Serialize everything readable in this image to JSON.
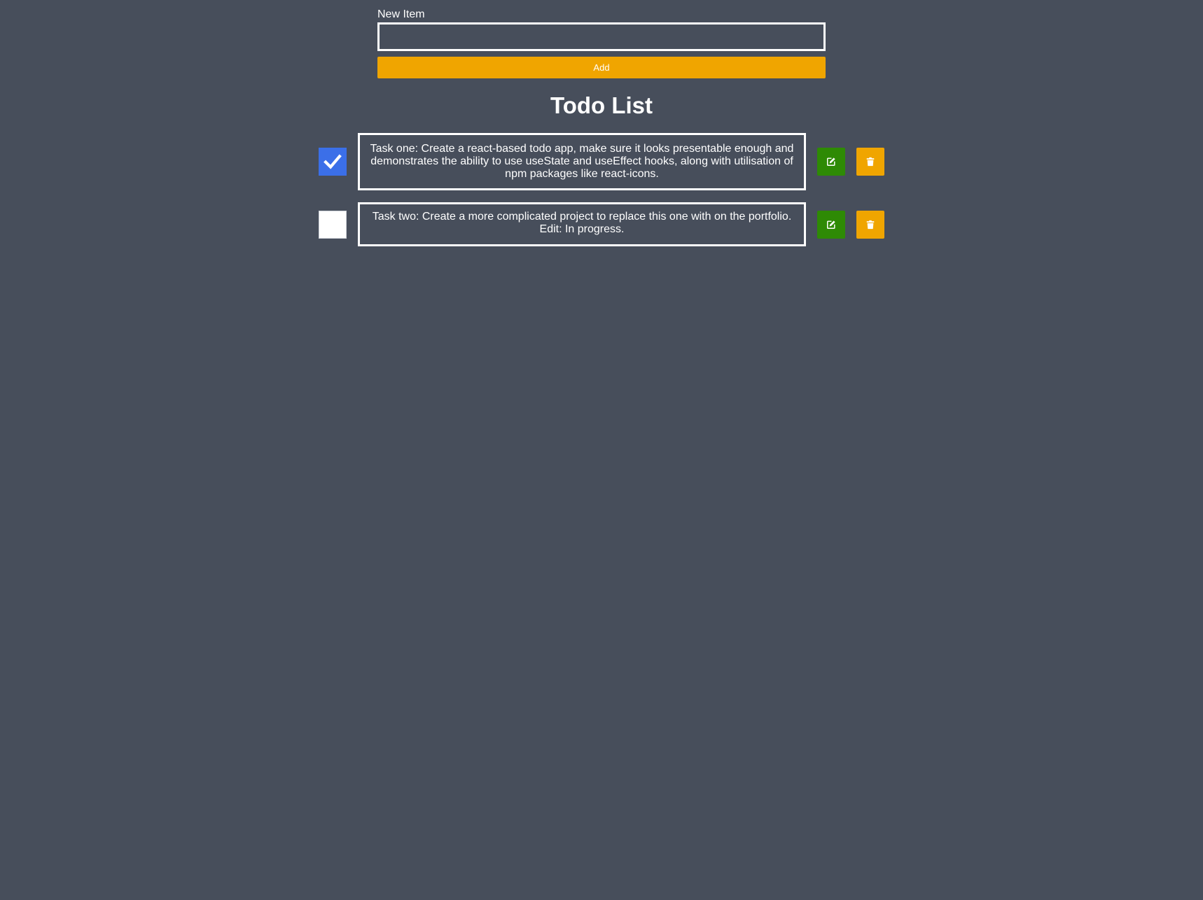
{
  "form": {
    "label": "New Item",
    "input_value": "",
    "add_label": "Add"
  },
  "list": {
    "title": "Todo List",
    "items": [
      {
        "checked": true,
        "text": "Task one: Create a react-based todo app, make sure it looks presentable enough and demonstrates the ability to use useState and useEffect hooks, along with utilisation of npm packages like react-icons.",
        "edit_icon": "edit-icon",
        "delete_icon": "trash-icon"
      },
      {
        "checked": false,
        "text": "Task two: Create a more complicated project to replace this one with on the portfolio. Edit: In progress.",
        "edit_icon": "edit-icon",
        "delete_icon": "trash-icon"
      }
    ]
  },
  "colors": {
    "background": "#474e5b",
    "accent": "#f0a500",
    "edit_button": "#2e8a05",
    "checkbox_checked": "#3b6fe8",
    "text": "#ffffff"
  }
}
